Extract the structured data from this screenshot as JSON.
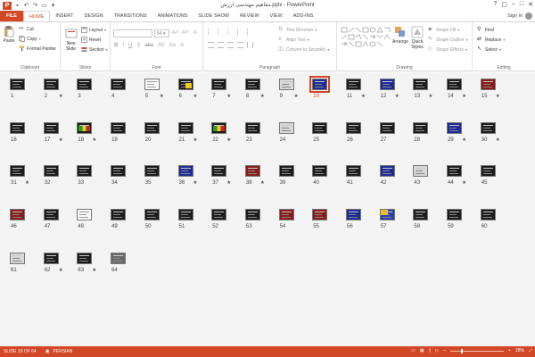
{
  "window": {
    "title": "مفاهیم مهندسی ارزش.pptx - PowerPoint",
    "app_badge": "P",
    "controls": [
      "?",
      "▢",
      "–",
      "□",
      "✕"
    ]
  },
  "ribbon_tabs": [
    "FILE",
    "HOME",
    "INSERT",
    "DESIGN",
    "TRANSITIONS",
    "ANIMATIONS",
    "SLIDE SHOW",
    "REVIEW",
    "VIEW",
    "ADD-INS"
  ],
  "active_tab": "HOME",
  "sign_in": "Sign in",
  "clipboard": {
    "label": "Clipboard",
    "paste": "Paste",
    "cut": "Cut",
    "copy": "Copy",
    "format_painter": "Format Painter"
  },
  "slides_group": {
    "label": "Slides",
    "new_slide": "New Slide",
    "layout": "Layout",
    "reset": "Reset",
    "section": "Section"
  },
  "font_group": {
    "label": "Font",
    "size": "54"
  },
  "paragraph_group": {
    "label": "Paragraph",
    "text_direction": "Text Direction",
    "align_text": "Align Text",
    "convert_smartart": "Convert to SmartArt"
  },
  "drawing_group": {
    "label": "Drawing",
    "arrange": "Arrange",
    "quick_styles": "Quick Styles",
    "shape_fill": "Shape Fill",
    "shape_outline": "Shape Outline",
    "shape_effects": "Shape Effects"
  },
  "editing_group": {
    "label": "Editing",
    "find": "Find",
    "replace": "Replace",
    "select": "Select"
  },
  "slides": [
    {
      "n": "1",
      "star": false,
      "v": "dark"
    },
    {
      "n": "2",
      "star": true,
      "v": "dark"
    },
    {
      "n": "3",
      "star": false,
      "v": "dark"
    },
    {
      "n": "4",
      "star": false,
      "v": "dark"
    },
    {
      "n": "5",
      "star": true,
      "v": "white"
    },
    {
      "n": "6",
      "star": true,
      "v": "yellow"
    },
    {
      "n": "7",
      "star": true,
      "v": "dark"
    },
    {
      "n": "8",
      "star": true,
      "v": "dark"
    },
    {
      "n": "9",
      "star": true,
      "v": "light"
    },
    {
      "n": "10",
      "star": false,
      "v": "blue",
      "selected": true
    },
    {
      "n": "11",
      "star": true,
      "v": "dark"
    },
    {
      "n": "12",
      "star": true,
      "v": "blue"
    },
    {
      "n": "13",
      "star": true,
      "v": "dark"
    },
    {
      "n": "14",
      "star": true,
      "v": "dark"
    },
    {
      "n": "15",
      "star": true,
      "v": "red"
    },
    {
      "n": "16",
      "star": false,
      "v": "dark"
    },
    {
      "n": "17",
      "star": true,
      "v": "dark"
    },
    {
      "n": "18",
      "star": true,
      "v": "multi"
    },
    {
      "n": "19",
      "star": false,
      "v": "dark"
    },
    {
      "n": "20",
      "star": false,
      "v": "dark"
    },
    {
      "n": "21",
      "star": true,
      "v": "dark"
    },
    {
      "n": "22",
      "star": true,
      "v": "multi"
    },
    {
      "n": "23",
      "star": false,
      "v": "dark"
    },
    {
      "n": "24",
      "star": false,
      "v": "light"
    },
    {
      "n": "25",
      "star": false,
      "v": "dark"
    },
    {
      "n": "26",
      "star": false,
      "v": "dark"
    },
    {
      "n": "27",
      "star": false,
      "v": "dark"
    },
    {
      "n": "28",
      "star": false,
      "v": "dark"
    },
    {
      "n": "29",
      "star": true,
      "v": "blue"
    },
    {
      "n": "30",
      "star": true,
      "v": "dark"
    },
    {
      "n": "31",
      "star": true,
      "v": "dark"
    },
    {
      "n": "32",
      "star": false,
      "v": "dark"
    },
    {
      "n": "33",
      "star": false,
      "v": "dark"
    },
    {
      "n": "34",
      "star": false,
      "v": "dark"
    },
    {
      "n": "35",
      "star": false,
      "v": "dark"
    },
    {
      "n": "36",
      "star": true,
      "v": "blue"
    },
    {
      "n": "37",
      "star": true,
      "v": "dark"
    },
    {
      "n": "38",
      "star": true,
      "v": "red"
    },
    {
      "n": "39",
      "star": false,
      "v": "dark"
    },
    {
      "n": "40",
      "star": false,
      "v": "dark"
    },
    {
      "n": "41",
      "star": false,
      "v": "dark"
    },
    {
      "n": "42",
      "star": false,
      "v": "blue"
    },
    {
      "n": "43",
      "star": false,
      "v": "light"
    },
    {
      "n": "44",
      "star": true,
      "v": "dark"
    },
    {
      "n": "45",
      "star": false,
      "v": "dark"
    },
    {
      "n": "46",
      "star": false,
      "v": "red"
    },
    {
      "n": "47",
      "star": false,
      "v": "dark"
    },
    {
      "n": "48",
      "star": false,
      "v": "white"
    },
    {
      "n": "49",
      "star": false,
      "v": "dark"
    },
    {
      "n": "50",
      "star": false,
      "v": "dark"
    },
    {
      "n": "51",
      "star": false,
      "v": "dark"
    },
    {
      "n": "52",
      "star": false,
      "v": "dark"
    },
    {
      "n": "53",
      "star": false,
      "v": "dark"
    },
    {
      "n": "54",
      "star": false,
      "v": "red"
    },
    {
      "n": "55",
      "star": false,
      "v": "red"
    },
    {
      "n": "56",
      "star": false,
      "v": "blue"
    },
    {
      "n": "57",
      "star": false,
      "v": "map"
    },
    {
      "n": "58",
      "star": false,
      "v": "dark"
    },
    {
      "n": "59",
      "star": false,
      "v": "dark"
    },
    {
      "n": "60",
      "star": false,
      "v": "dark"
    },
    {
      "n": "61",
      "star": false,
      "v": "light"
    },
    {
      "n": "62",
      "star": true,
      "v": "dark"
    },
    {
      "n": "63",
      "star": true,
      "v": "dark"
    },
    {
      "n": "64",
      "star": false,
      "v": "photo"
    }
  ],
  "status": {
    "slide_of": "SLIDE 10 OF 64",
    "language": "PERSIAN",
    "zoom": "28%"
  },
  "colors": {
    "accent": "#d24726",
    "sorter_bg": "#f3f3f3"
  }
}
